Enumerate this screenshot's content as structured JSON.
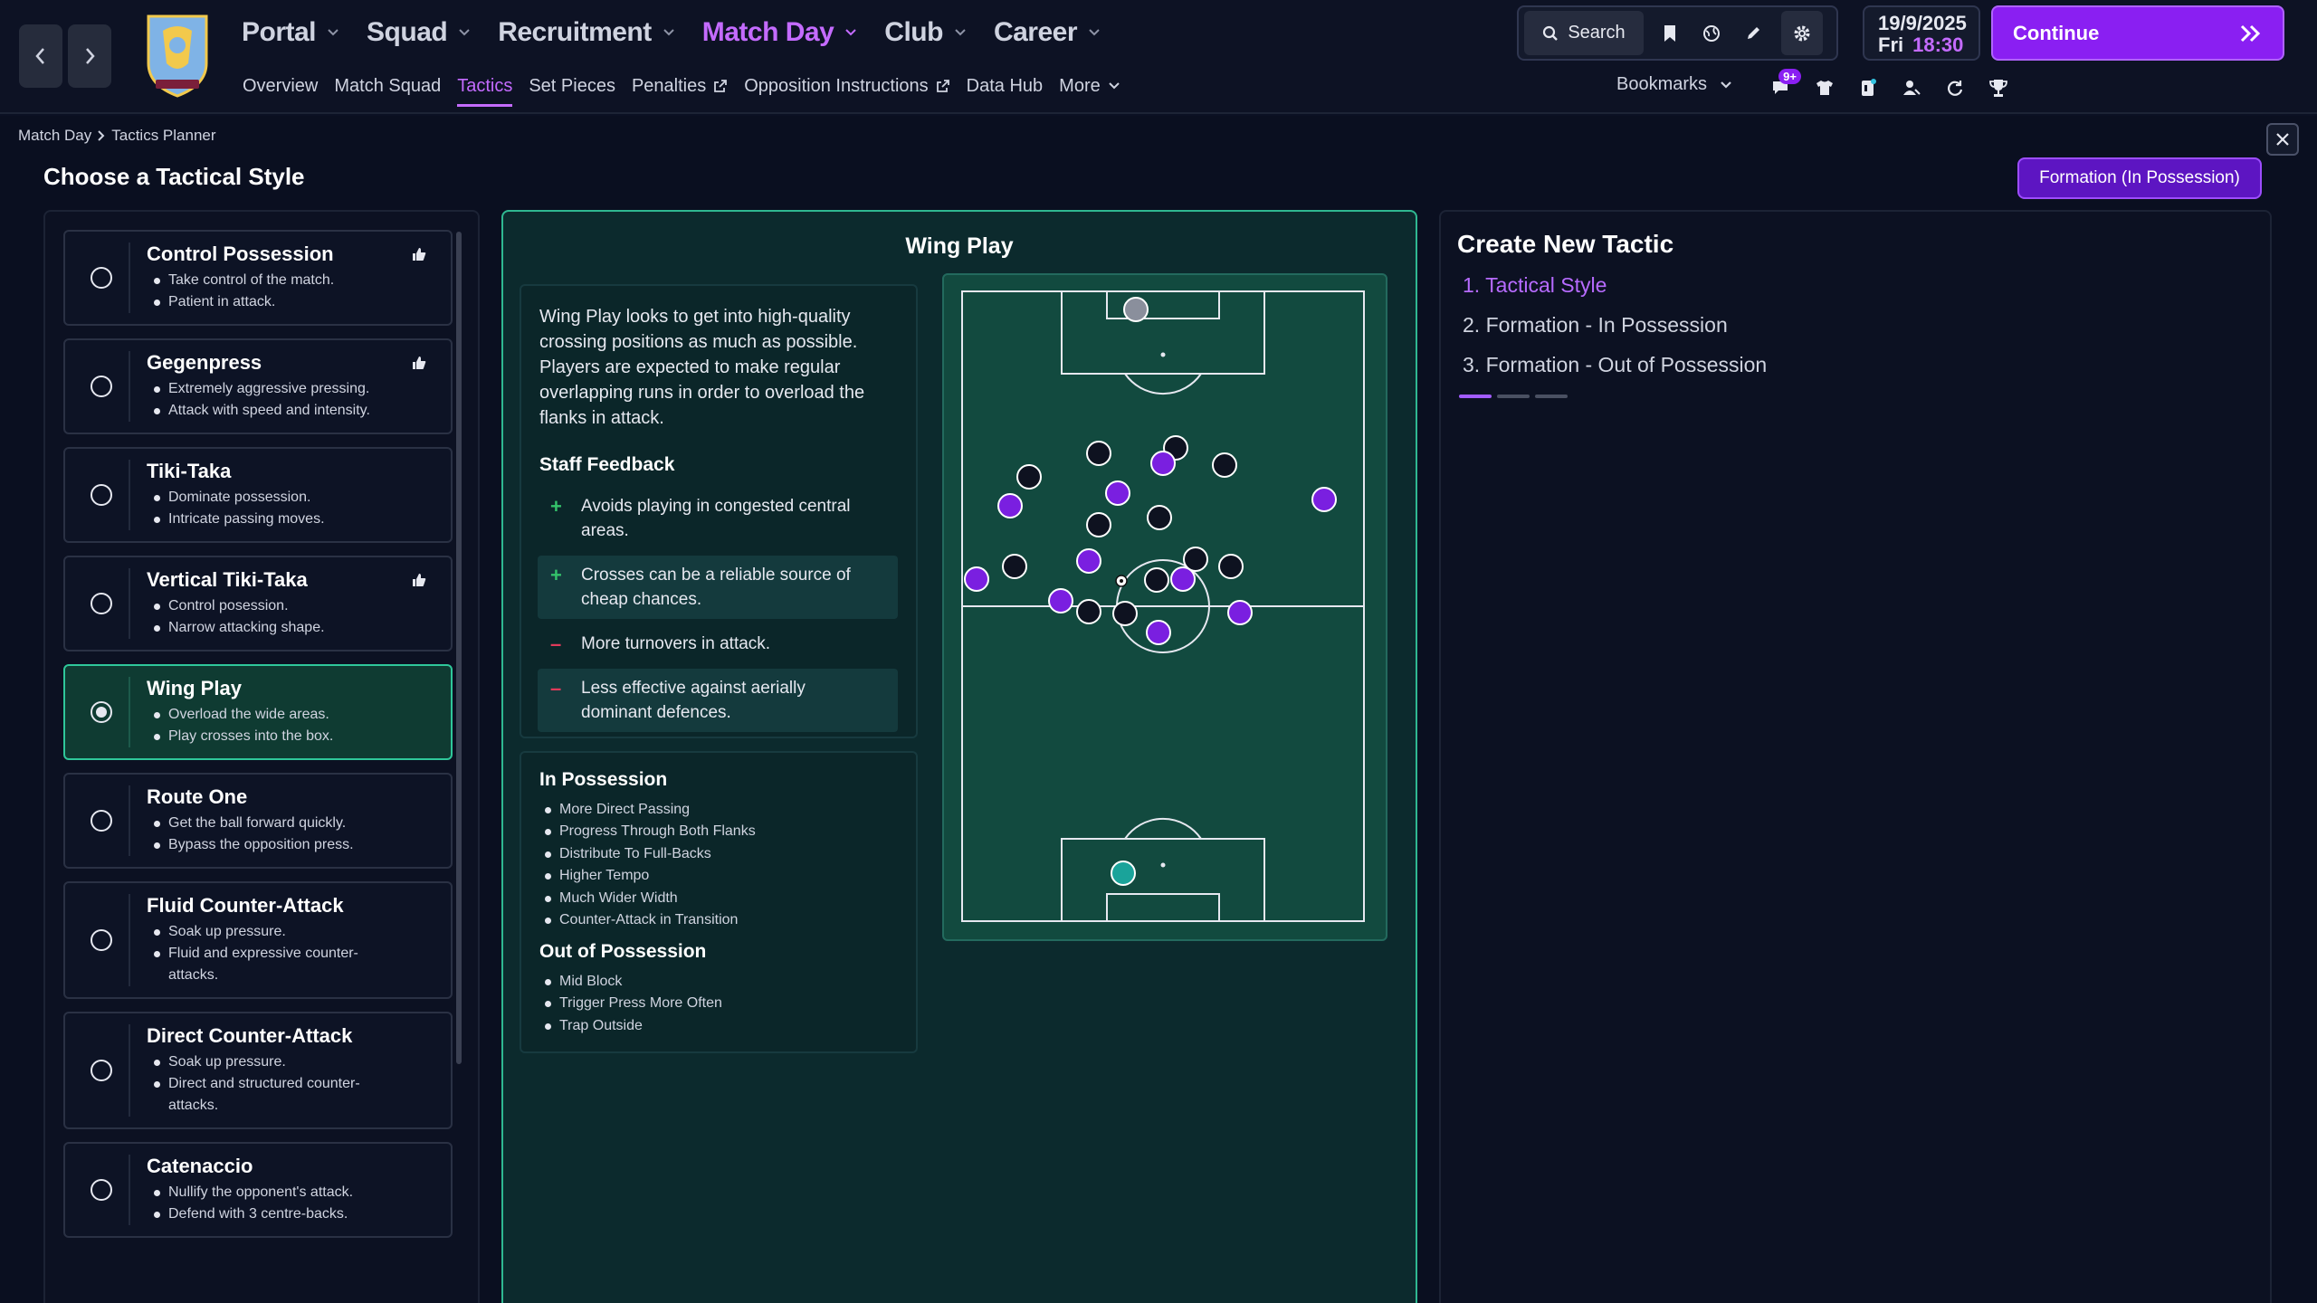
{
  "nav": {
    "main": [
      {
        "label": "Portal",
        "active": false
      },
      {
        "label": "Squad",
        "active": false
      },
      {
        "label": "Recruitment",
        "active": false
      },
      {
        "label": "Match Day",
        "active": true
      },
      {
        "label": "Club",
        "active": false
      },
      {
        "label": "Career",
        "active": false
      }
    ],
    "sub": [
      {
        "label": "Overview",
        "active": false,
        "external": false
      },
      {
        "label": "Match Squad",
        "active": false,
        "external": false
      },
      {
        "label": "Tactics",
        "active": true,
        "external": false
      },
      {
        "label": "Set Pieces",
        "active": false,
        "external": false
      },
      {
        "label": "Penalties",
        "active": false,
        "external": true
      },
      {
        "label": "Opposition Instructions",
        "active": false,
        "external": true
      },
      {
        "label": "Data Hub",
        "active": false,
        "external": false
      },
      {
        "label": "More",
        "active": false,
        "external": false
      }
    ]
  },
  "toolbar": {
    "search_label": "Search",
    "date": "19/9/2025",
    "day": "Fri",
    "time": "18:30",
    "continue_label": "Continue",
    "bookmarks_label": "Bookmarks",
    "notification_count": "9+"
  },
  "breadcrumb": {
    "parent": "Match Day",
    "current": "Tactics Planner"
  },
  "page": {
    "title": "Choose a Tactical Style",
    "formation_button": "Formation (In Possession)"
  },
  "styles": [
    {
      "name": "Control Possession",
      "bullets": [
        "Take control of the match.",
        "Patient in attack."
      ],
      "recommended": true,
      "selected": false
    },
    {
      "name": "Gegenpress",
      "bullets": [
        "Extremely aggressive pressing.",
        "Attack with speed and intensity."
      ],
      "recommended": true,
      "selected": false
    },
    {
      "name": "Tiki-Taka",
      "bullets": [
        "Dominate possession.",
        "Intricate passing moves."
      ],
      "recommended": false,
      "selected": false
    },
    {
      "name": "Vertical Tiki-Taka",
      "bullets": [
        "Control posession.",
        "Narrow attacking shape."
      ],
      "recommended": true,
      "selected": false
    },
    {
      "name": "Wing Play",
      "bullets": [
        "Overload the wide areas.",
        "Play crosses into the box."
      ],
      "recommended": false,
      "selected": true
    },
    {
      "name": "Route One",
      "bullets": [
        "Get the ball forward quickly.",
        "Bypass the opposition press."
      ],
      "recommended": false,
      "selected": false
    },
    {
      "name": "Fluid Counter-Attack",
      "bullets": [
        "Soak up pressure.",
        "Fluid and expressive counter-",
        "attacks."
      ],
      "recommended": false,
      "selected": false
    },
    {
      "name": "Direct Counter-Attack",
      "bullets": [
        "Soak up pressure.",
        "Direct and structured counter-",
        "attacks."
      ],
      "recommended": false,
      "selected": false
    },
    {
      "name": "Catenaccio",
      "bullets": [
        "Nullify the opponent's attack.",
        "Defend with 3 centre-backs."
      ],
      "recommended": false,
      "selected": false
    }
  ],
  "selected_style": {
    "title": "Wing Play",
    "description_lines": [
      "Wing Play looks to get into high-quality",
      "crossing positions as much as possible.",
      "Players are expected to make regular",
      "overlapping runs in order to overload the",
      "flanks in attack."
    ],
    "staff_feedback_heading": "Staff Feedback",
    "feedback": [
      {
        "type": "plus",
        "lines": [
          "Avoids playing in congested central",
          "areas."
        ]
      },
      {
        "type": "plus",
        "lines": [
          "Crosses can be a reliable source of",
          "cheap chances."
        ]
      },
      {
        "type": "minus",
        "lines": [
          "More turnovers in attack."
        ]
      },
      {
        "type": "minus",
        "lines": [
          "Less effective against aerially",
          "dominant defences."
        ]
      }
    ],
    "in_possession_heading": "In Possession",
    "in_possession": [
      "More Direct Passing",
      "Progress Through Both Flanks",
      "Distribute To Full-Backs",
      "Higher Tempo",
      "Much Wider Width",
      "Counter-Attack in Transition"
    ],
    "out_of_possession_heading": "Out of Possession",
    "out_of_possession": [
      "Mid Block",
      "Trigger Press More Often",
      "Trap Outside"
    ]
  },
  "create_tactic": {
    "title": "Create New Tactic",
    "steps": [
      {
        "label": "1. Tactical Style",
        "active": true
      },
      {
        "label": "2. Formation - In Possession",
        "active": false
      },
      {
        "label": "3. Formation - Out of Possession",
        "active": false
      }
    ]
  },
  "colors": {
    "accent": "#c46bff",
    "team_player": "#7a1fe0",
    "opponent_player": "#0e1220",
    "selected_card": "#0f3b32",
    "pitch": "#124a3f",
    "plus": "#34c26a",
    "minus": "#e03a5a"
  }
}
